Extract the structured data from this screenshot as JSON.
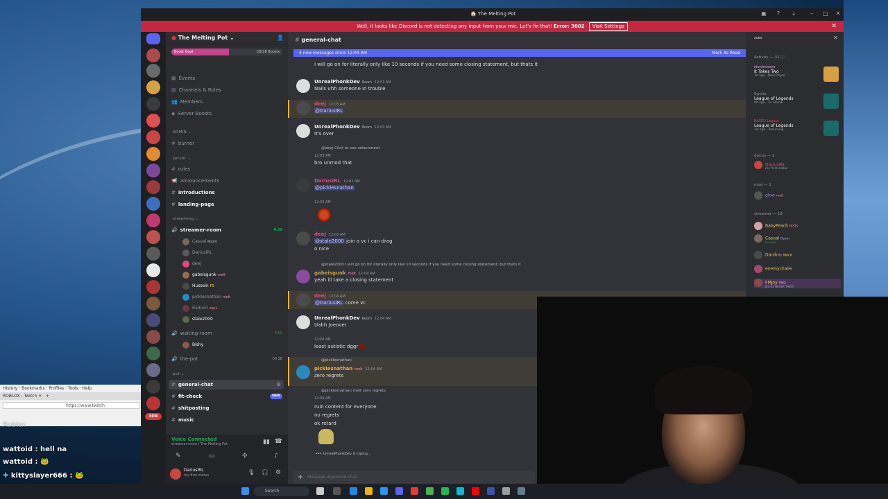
{
  "window": {
    "title": "The Melting Pot"
  },
  "banner": {
    "text": "Well, it looks like Discord is not detecting any input from your mic. Let's fix that!",
    "error": "Error: 3002",
    "button": "Visit Settings"
  },
  "server": {
    "name": "The Melting Pot",
    "boost_goal": "Boost Goal",
    "boosts": "18/28 Boosts"
  },
  "channels": {
    "nav": [
      "Events",
      "Channels & Roles",
      "Members",
      "Server Boosts"
    ],
    "cat_admin": "ADMIN",
    "burner": "burner",
    "cat_server": "server",
    "rules": "rules",
    "announcements": "announcements",
    "introductions": "introductions",
    "landing": "landing-page",
    "cat_streaming": "streaming",
    "streamer_room": "streamer-room",
    "streamer_room_time": "0:39",
    "voice_users": [
      "Casual",
      "DariusIRL",
      "deej",
      "gabeisgunk",
      "Hussein",
      "picklesnathan",
      "Radiant",
      "stale2000"
    ],
    "casual_tag": "Room",
    "gabe_tag": "melt",
    "hussein_tag": "FS",
    "pickles_tag": "melt",
    "radiant_tag": "sqcL",
    "waiting_room": "waiting-room",
    "waiting_time": "0:59",
    "waiting_user": "Bishy",
    "the_pot": "the-pot",
    "the_pot_counts": "00  28",
    "cat_pot": "pot",
    "general": "general-chat",
    "fitcheck": "fit-check",
    "fitcheck_badge": "NEW",
    "shitposting": "shitposting",
    "music": "music",
    "new_badge": "NEW"
  },
  "voice": {
    "status": "Voice Connected",
    "where": "streamer-room / The Melting Pot"
  },
  "user": {
    "name": "DariusIRL",
    "status": "my first status"
  },
  "chat": {
    "channel": "general-chat",
    "new_messages": "4 new messages since 12:04 AM",
    "mark_read": "Mark As Read",
    "top_line": "I will go on for literally only like 10 seconds if you need some closing statement, but thats it",
    "messages": [
      {
        "name": "UnrealPhonkDev",
        "tag": "Room",
        "time": "12:03 AM",
        "lines": [
          "Nails uhh someone in trouble"
        ]
      },
      {
        "name": "deej",
        "time": "12:03 AM",
        "lines": [
          "@DariusIRL"
        ]
      },
      {
        "name": "UnrealPhonkDev",
        "tag": "Room",
        "time": "12:03 AM",
        "lines": [
          "It's over"
        ]
      },
      {
        "reply": "@deej Click to see attachment",
        "time": "12:03 AM",
        "lines": [
          "bro unmod that"
        ]
      },
      {
        "name": "DariusIRL",
        "time": "12:03 AM",
        "lines": [
          "@picklesnathan"
        ]
      },
      {
        "time": "12:03 AM",
        "lines": [
          ""
        ]
      },
      {
        "name": "deej",
        "time": "12:03 AM",
        "lines": [
          "@stale2000 join a vc i can drag",
          "o nice"
        ]
      },
      {
        "reply": "@stale2000 I will go on for literally only like 10 seconds if you need some closing statement, but thats it",
        "name": "gabeisgunk",
        "tag": "melt",
        "time": "12:04 AM",
        "lines": [
          "yeah ill take a closing statement"
        ]
      },
      {
        "name": "deej",
        "time": "12:04 AM",
        "lines": [
          "@DariusIRL come vc"
        ]
      },
      {
        "name": "UnrealPhonkDev",
        "tag": "Room",
        "time": "12:04 AM",
        "lines": [
          "Uahh joeover"
        ]
      },
      {
        "time": "12:04 AM",
        "lines": [
          "least autistic dggr"
        ]
      },
      {
        "reply": "@picklesnathan",
        "name": "picklesnathan",
        "tag": "melt",
        "time": "12:04 AM",
        "lines": [
          "zero regrets"
        ]
      },
      {
        "reply": "@picklesnathan melt zero regrets",
        "time": "12:04 AM",
        "lines": [
          "ruin content for everyone",
          "no regrets",
          "ok retard"
        ]
      }
    ],
    "typing": "UnrealPhonkDev is typing...",
    "composer_placeholder": "Message #general-chat"
  },
  "members": {
    "activity_header": "Activity — 31",
    "activities": [
      {
        "name": "idontmissya",
        "game": "It Takes Two",
        "sub": "1d ago · New Player"
      },
      {
        "name": "Syndro",
        "game": "League of Legends",
        "sub": "6h ago · 3x Streak"
      },
      {
        "name": "BASED Legacy",
        "game": "League of Legends",
        "sub": "1w ago · Returning"
      }
    ],
    "darius_header": "darius — 1",
    "darius_member": "DariusIRL",
    "darius_status": "my first status",
    "mod_header": "mod — 1",
    "mod_member": "glow",
    "mod_tag": "melt",
    "streamer_header": "streamer — 18",
    "streamers": [
      {
        "name": "BabyPeach",
        "tag": "BPDS"
      },
      {
        "name": "Casual",
        "tag": "Room",
        "sub": "In voice"
      },
      {
        "name": "Danihru",
        "tag": "WACK"
      },
      {
        "name": "enemychalie",
        "tag": ""
      },
      {
        "name": "FMJoy",
        "tag": "SMD",
        "sub": "JES US NEVER THEM"
      }
    ]
  },
  "twitch": {
    "menu": [
      "History",
      "Bookmarks",
      "Profiles",
      "Tools",
      "Help"
    ],
    "tab": "ROBLOX - Twitch",
    "url": "https://www.twitch",
    "chat": [
      {
        "user": "wattoid",
        "msg": "hell na"
      },
      {
        "user": "wattoid",
        "msg": ""
      },
      {
        "user": "kittyslayer666",
        "msg": ""
      },
      {
        "user": "kittyslayer666",
        "msg": ""
      }
    ],
    "faded": "Roblox"
  },
  "taskbar": {
    "search": "Search"
  },
  "colors": {
    "discord_bg": "#313338",
    "sidebar": "#2b2d31",
    "rail": "#1e1f22",
    "blurple": "#5865f2",
    "error": "#c7263f",
    "online": "#23a55a",
    "deej": "#e3487f",
    "pickles": "#f0b232"
  }
}
